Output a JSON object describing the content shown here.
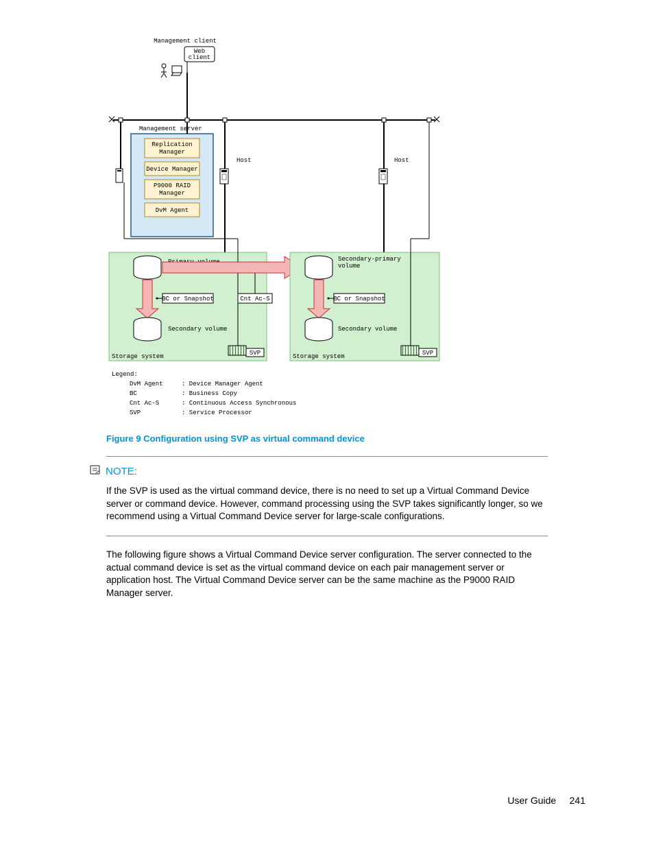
{
  "diagram": {
    "client_label": "Management client",
    "web_client": "Web\nclient",
    "mgmt_server": "Management server",
    "mgmt_items": [
      "Replication\nManager",
      "Device Manager",
      "P9000 RAID\nManager",
      "DvM Agent"
    ],
    "host": "Host",
    "primary_volume": "Primary volume",
    "secondary_primary": "Secondary-primary\nvolume",
    "bc_snapshot": "BC or Snapshot",
    "cnt_acs": "Cnt Ac-S",
    "secondary_volume": "Secondary volume",
    "storage_system": "Storage system",
    "svp": "SVP",
    "legend_title": "Legend:",
    "legend": [
      {
        "k": "DvM Agent",
        "v": ": Device Manager Agent"
      },
      {
        "k": "BC",
        "v": ": Business Copy"
      },
      {
        "k": "Cnt Ac-S",
        "v": ": Continuous Access Synchronous"
      },
      {
        "k": "SVP",
        "v": ": Service Processor"
      }
    ]
  },
  "caption": "Figure 9 Configuration using SVP as virtual command device",
  "note_label": "NOTE:",
  "note_body": "If the SVP is used as the virtual command device, there is no need to set up a Virtual Command Device server or command device. However, command processing using the SVP takes significantly longer, so we recommend using a Virtual Command Device server for large-scale configurations.",
  "para2": "The following figure shows a Virtual Command Device server configuration. The server connected to the actual command device is set as the virtual command device on each pair management server or application host. The Virtual Command Device server can be the same machine as the P9000 RAID Manager server.",
  "footer_label": "User Guide",
  "page_no": "241"
}
